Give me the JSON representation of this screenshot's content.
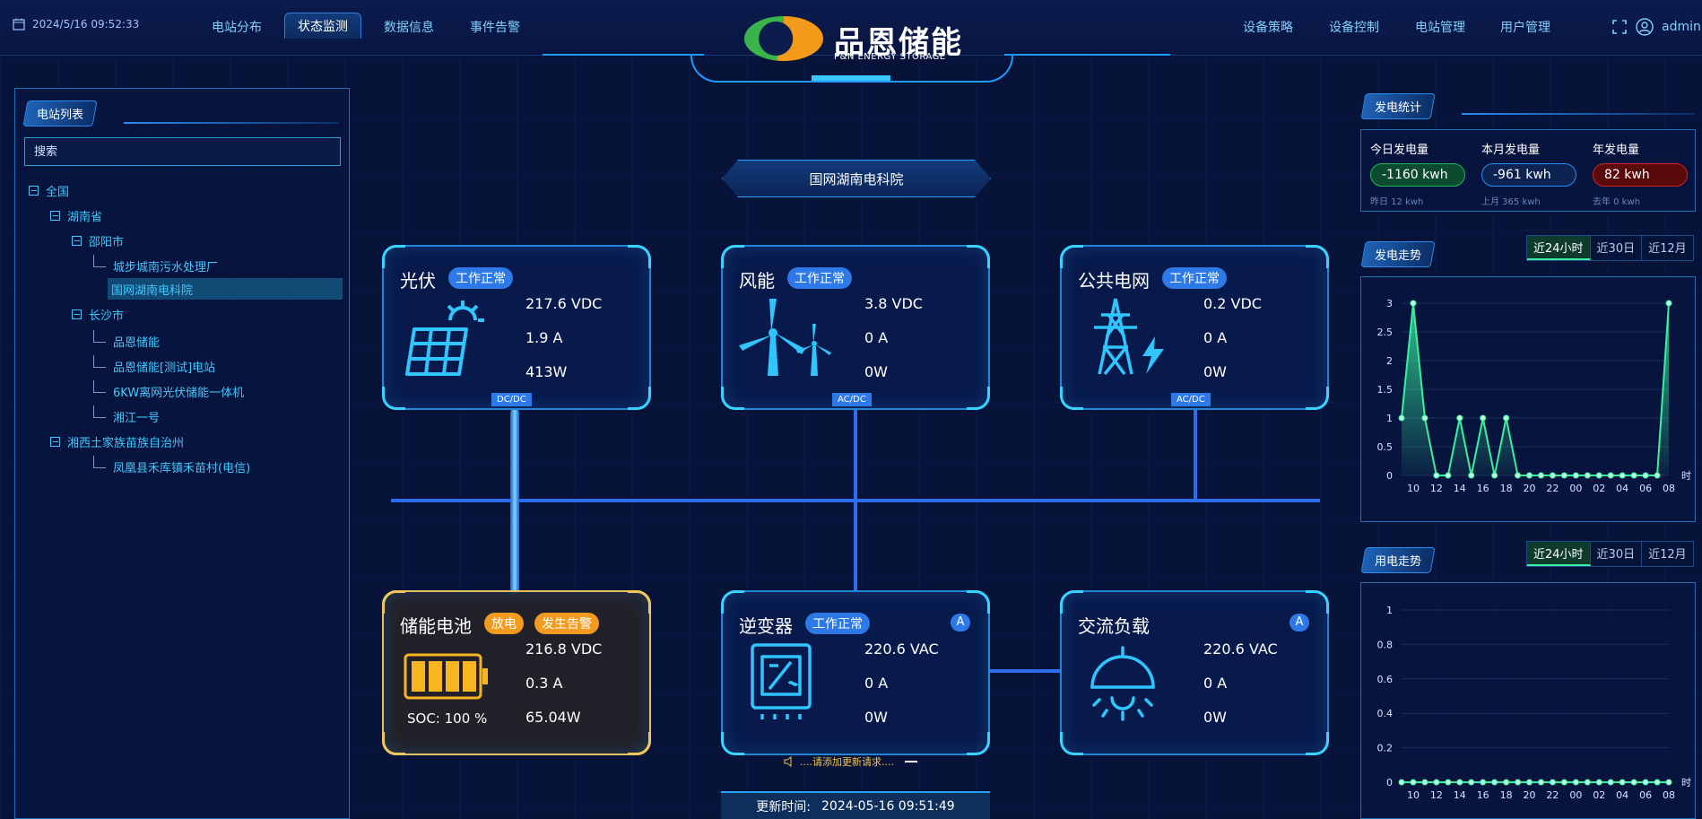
{
  "header": {
    "datetime": "2024/5/16 09:52:33",
    "nav_left": [
      "电站分布",
      "状态监测",
      "数据信息",
      "事件告警"
    ],
    "active_tab": "状态监测",
    "nav_right": [
      "设备策略",
      "设备控制",
      "电站管理",
      "用户管理"
    ],
    "user": "admin",
    "logo_title": "品恩储能",
    "logo_subtitle": "P&N ENERGY STORAGE"
  },
  "sidebar": {
    "title": "电站列表",
    "search_placeholder": "搜索",
    "tree": {
      "root": "全国",
      "province1": "湖南省",
      "city1": "邵阳市",
      "city1_items": [
        "城步城南污水处理厂",
        "国网湖南电科院"
      ],
      "city2": "长沙市",
      "city2_items": [
        "品恩储能",
        "品恩储能[测试]电站",
        "6KW离网光伏储能一体机",
        "湘江一号"
      ],
      "province2": "湘西土家族苗族自治州",
      "province2_items": [
        "凤凰县禾库镇禾苗村(电信)"
      ]
    },
    "selected": "国网湖南电科院"
  },
  "main": {
    "station_name": "国网湖南电科院",
    "cards": {
      "pv": {
        "title": "光伏",
        "status": "工作正常",
        "values": [
          "217.6 VDC",
          "1.9 A",
          "413W"
        ],
        "port": "DC/DC",
        "icon": "solar-panel-icon"
      },
      "wind": {
        "title": "风能",
        "status": "工作正常",
        "values": [
          "3.8 VDC",
          "0 A",
          "0W"
        ],
        "port": "AC/DC",
        "icon": "wind-turbine-icon"
      },
      "grid": {
        "title": "公共电网",
        "status": "工作正常",
        "values": [
          "0.2 VDC",
          "0 A",
          "0W"
        ],
        "port": "AC/DC",
        "icon": "power-tower-icon"
      },
      "battery": {
        "title": "储能电池",
        "status1": "放电",
        "status2": "发生告警",
        "values": [
          "216.8 VDC",
          "0.3 A",
          "65.04W"
        ],
        "soc": "SOC: 100 %",
        "icon": "battery-icon"
      },
      "inverter": {
        "title": "逆变器",
        "status": "工作正常",
        "badge": "A",
        "values": [
          "220.6 VAC",
          "0 A",
          "0W"
        ],
        "icon": "inverter-icon"
      },
      "load": {
        "title": "交流负载",
        "badge": "A",
        "values": [
          "220.6 VAC",
          "0 A",
          "0W"
        ],
        "icon": "lamp-icon"
      }
    },
    "notice": "....请添加更新请求....",
    "update_label": "更新时间:",
    "update_time": "2024-05-16 09:51:49"
  },
  "right": {
    "stats_title": "发电统计",
    "stats": [
      {
        "label": "今日发电量",
        "value": "-1160 kwh",
        "sub": "昨日 12 kwh",
        "color": "#1fb45a"
      },
      {
        "label": "本月发电量",
        "value": "-961 kwh",
        "sub": "上月 365 kwh",
        "color": "#2d8cf0"
      },
      {
        "label": "年发电量",
        "value": "82 kwh",
        "sub": "去年 0 kwh",
        "color": "#d02020"
      }
    ],
    "gen_trend_title": "发电走势",
    "use_trend_title": "用电走势",
    "ranges": [
      "近24小时",
      "近30日",
      "近12月"
    ],
    "active_range": "近24小时"
  },
  "chart_data": [
    {
      "type": "area",
      "title": "发电走势",
      "xlabel": "时",
      "x": [
        "09",
        "10",
        "11",
        "12",
        "13",
        "14",
        "15",
        "16",
        "17",
        "18",
        "19",
        "20",
        "21",
        "22",
        "23",
        "00",
        "01",
        "02",
        "03",
        "04",
        "05",
        "06",
        "07",
        "08"
      ],
      "tick_labels": [
        "10",
        "12",
        "14",
        "16",
        "18",
        "20",
        "22",
        "00",
        "02",
        "04",
        "06",
        "08"
      ],
      "values": [
        1,
        3,
        1,
        0,
        0,
        1,
        0,
        1,
        0,
        1,
        0,
        0,
        0,
        0,
        0,
        0,
        0,
        0,
        0,
        0,
        0,
        0,
        0,
        3
      ],
      "yticks": [
        0,
        0.5,
        1,
        1.5,
        2,
        2.5,
        3
      ],
      "ylim": [
        0,
        3
      ],
      "grid": true,
      "color": "#3af0a0"
    },
    {
      "type": "line",
      "title": "用电走势",
      "xlabel": "时",
      "x": [
        "09",
        "10",
        "11",
        "12",
        "13",
        "14",
        "15",
        "16",
        "17",
        "18",
        "19",
        "20",
        "21",
        "22",
        "23",
        "00",
        "01",
        "02",
        "03",
        "04",
        "05",
        "06",
        "07",
        "08"
      ],
      "tick_labels": [
        "10",
        "12",
        "14",
        "16",
        "18",
        "20",
        "22",
        "00",
        "02",
        "04",
        "06",
        "08"
      ],
      "values": [
        0,
        0,
        0,
        0,
        0,
        0,
        0,
        0,
        0,
        0,
        0,
        0,
        0,
        0,
        0,
        0,
        0,
        0,
        0,
        0,
        0,
        0,
        0,
        0
      ],
      "yticks": [
        0,
        0.2,
        0.4,
        0.6,
        0.8,
        1
      ],
      "ylim": [
        0,
        1
      ],
      "grid": true,
      "color": "#3af0a0"
    }
  ]
}
